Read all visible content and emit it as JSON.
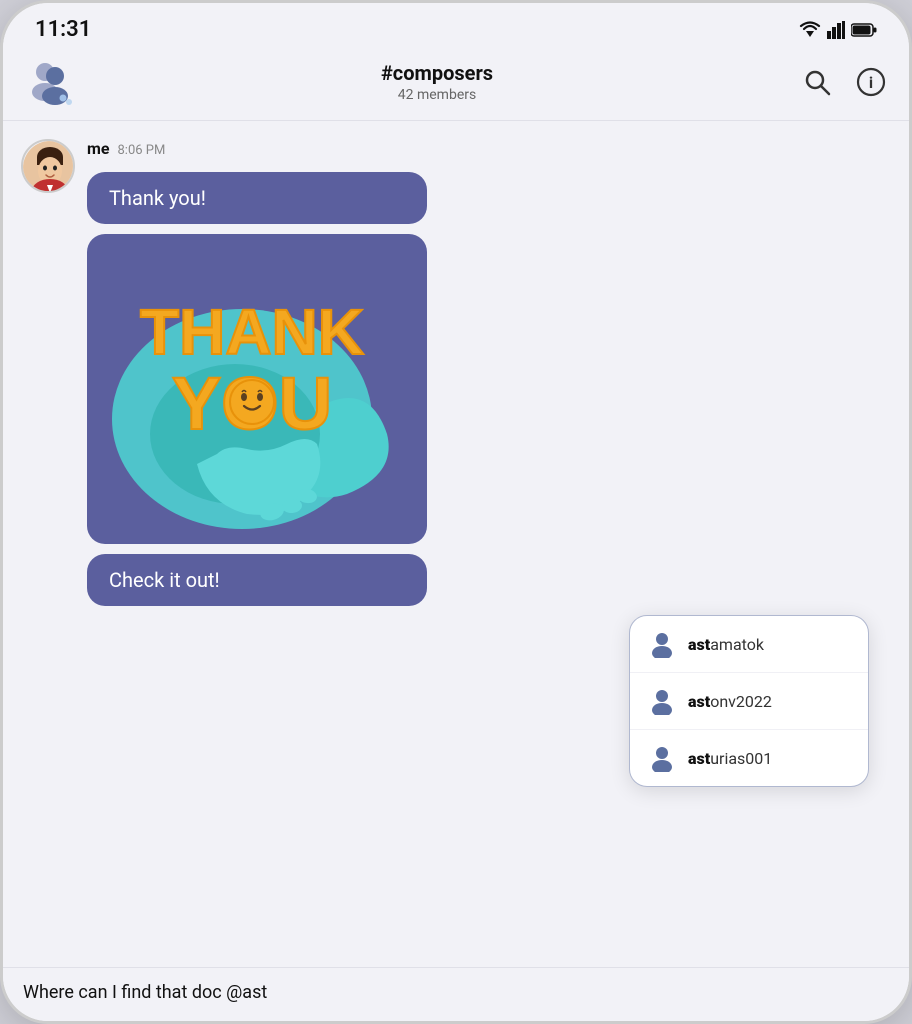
{
  "status_bar": {
    "time": "11:31",
    "wifi": "▲",
    "signal": "▲",
    "battery": "▊"
  },
  "header": {
    "channel": "#composers",
    "members": "42 members",
    "search_label": "Search",
    "info_label": "Info"
  },
  "message": {
    "sender": "me",
    "time": "8:06 PM",
    "bubble1": "Thank you!",
    "bubble3": "Check it out!"
  },
  "sticker": {
    "alt": "Thank You sticker"
  },
  "autocomplete": {
    "items": [
      {
        "prefix": "ast",
        "suffix": "amatok"
      },
      {
        "prefix": "ast",
        "suffix": "onv2022"
      },
      {
        "prefix": "ast",
        "suffix": "urias001"
      }
    ]
  },
  "input": {
    "text": "Where can I find that doc @ast"
  }
}
